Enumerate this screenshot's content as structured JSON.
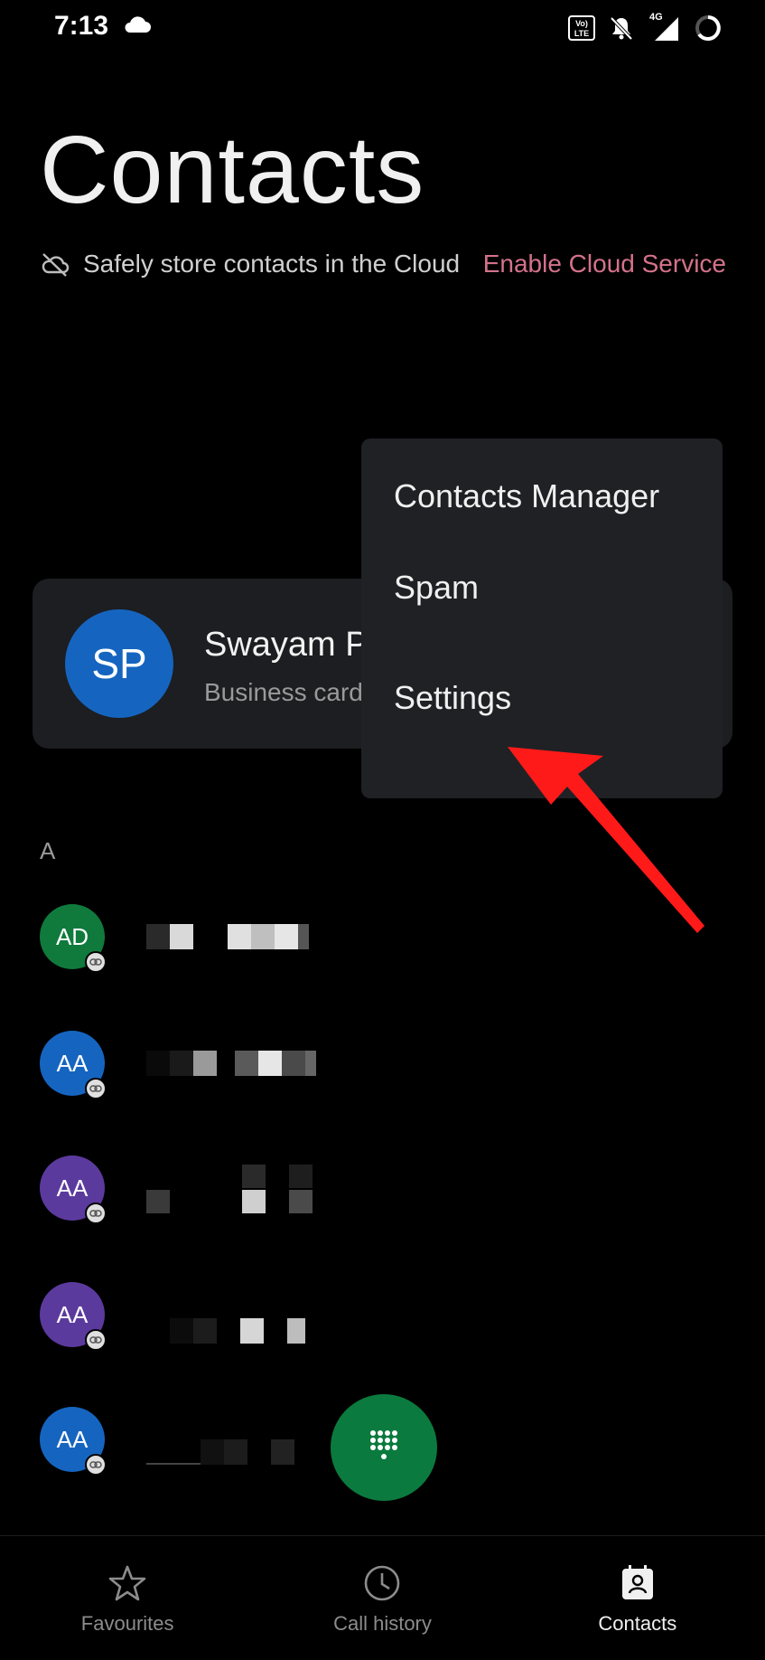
{
  "status_bar": {
    "time": "7:13",
    "network": "4G",
    "volte_top": "Vo)",
    "volte_bottom": "LTE"
  },
  "header": {
    "title": "Contacts",
    "cloud_notice": "Safely store contacts in the Cloud",
    "cloud_link": "Enable Cloud Service"
  },
  "profile": {
    "initials": "SP",
    "name": "Swayam P",
    "subtitle": "Business card",
    "avatar_color": "#1565c0"
  },
  "popup_menu": {
    "items": [
      {
        "label": "Contacts Manager"
      },
      {
        "label": "Spam"
      },
      {
        "label": "Settings"
      }
    ]
  },
  "contacts": {
    "section_letter": "A",
    "items": [
      {
        "initials": "AD",
        "color": "#0f7a3c"
      },
      {
        "initials": "AA",
        "color": "#1565c0"
      },
      {
        "initials": "AA",
        "color": "#5b3a9e"
      },
      {
        "initials": "AA",
        "color": "#5b3a9e"
      },
      {
        "initials": "AA",
        "color": "#1565c0"
      }
    ]
  },
  "bottom_nav": {
    "items": [
      {
        "label": "Favourites",
        "icon": "star-icon"
      },
      {
        "label": "Call history",
        "icon": "clock-icon"
      },
      {
        "label": "Contacts",
        "icon": "contact-card-icon",
        "active": true
      }
    ]
  },
  "colors": {
    "accent": "#d4728b",
    "fab": "#0b7a3e",
    "annotation_arrow": "#ff1a1a"
  }
}
